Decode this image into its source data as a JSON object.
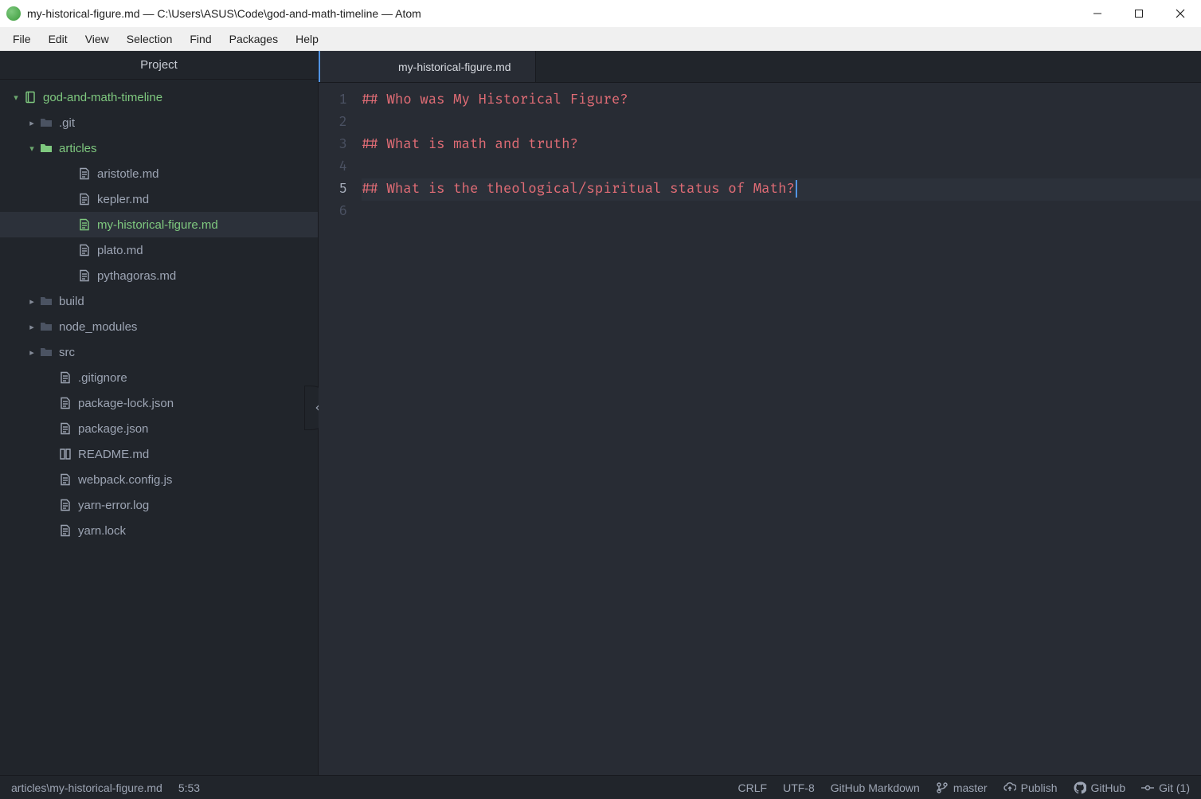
{
  "window": {
    "title": "my-historical-figure.md — C:\\Users\\ASUS\\Code\\god-and-math-timeline — Atom"
  },
  "menu": {
    "items": [
      "File",
      "Edit",
      "View",
      "Selection",
      "Find",
      "Packages",
      "Help"
    ]
  },
  "sidebar": {
    "header": "Project",
    "root": "god-and-math-timeline",
    "folders": {
      "git": ".git",
      "articles": "articles",
      "build": "build",
      "node_modules": "node_modules",
      "src": "src"
    },
    "articles_files": {
      "aristotle": "aristotle.md",
      "kepler": "kepler.md",
      "myhist": "my-historical-figure.md",
      "plato": "plato.md",
      "pythagoras": "pythagoras.md"
    },
    "root_files": {
      "gitignore": ".gitignore",
      "pkglock": "package-lock.json",
      "pkg": "package.json",
      "readme": "README.md",
      "webpack": "webpack.config.js",
      "yarnerr": "yarn-error.log",
      "yarnlock": "yarn.lock"
    }
  },
  "tabs": {
    "active": "my-historical-figure.md"
  },
  "editor": {
    "lines": {
      "l1": "## Who was My Historical Figure?",
      "l2": "",
      "l3": "## What is math and truth?",
      "l4": "",
      "l5": "## What is the theological/spiritual status of Math?",
      "l6": ""
    },
    "numbers": {
      "n1": "1",
      "n2": "2",
      "n3": "3",
      "n4": "4",
      "n5": "5",
      "n6": "6"
    }
  },
  "status": {
    "path": "articles\\my-historical-figure.md",
    "cursor": "5:53",
    "eol": "CRLF",
    "encoding": "UTF-8",
    "grammar": "GitHub Markdown",
    "branch": "master",
    "publish": "Publish",
    "github": "GitHub",
    "git": "Git (1)"
  }
}
